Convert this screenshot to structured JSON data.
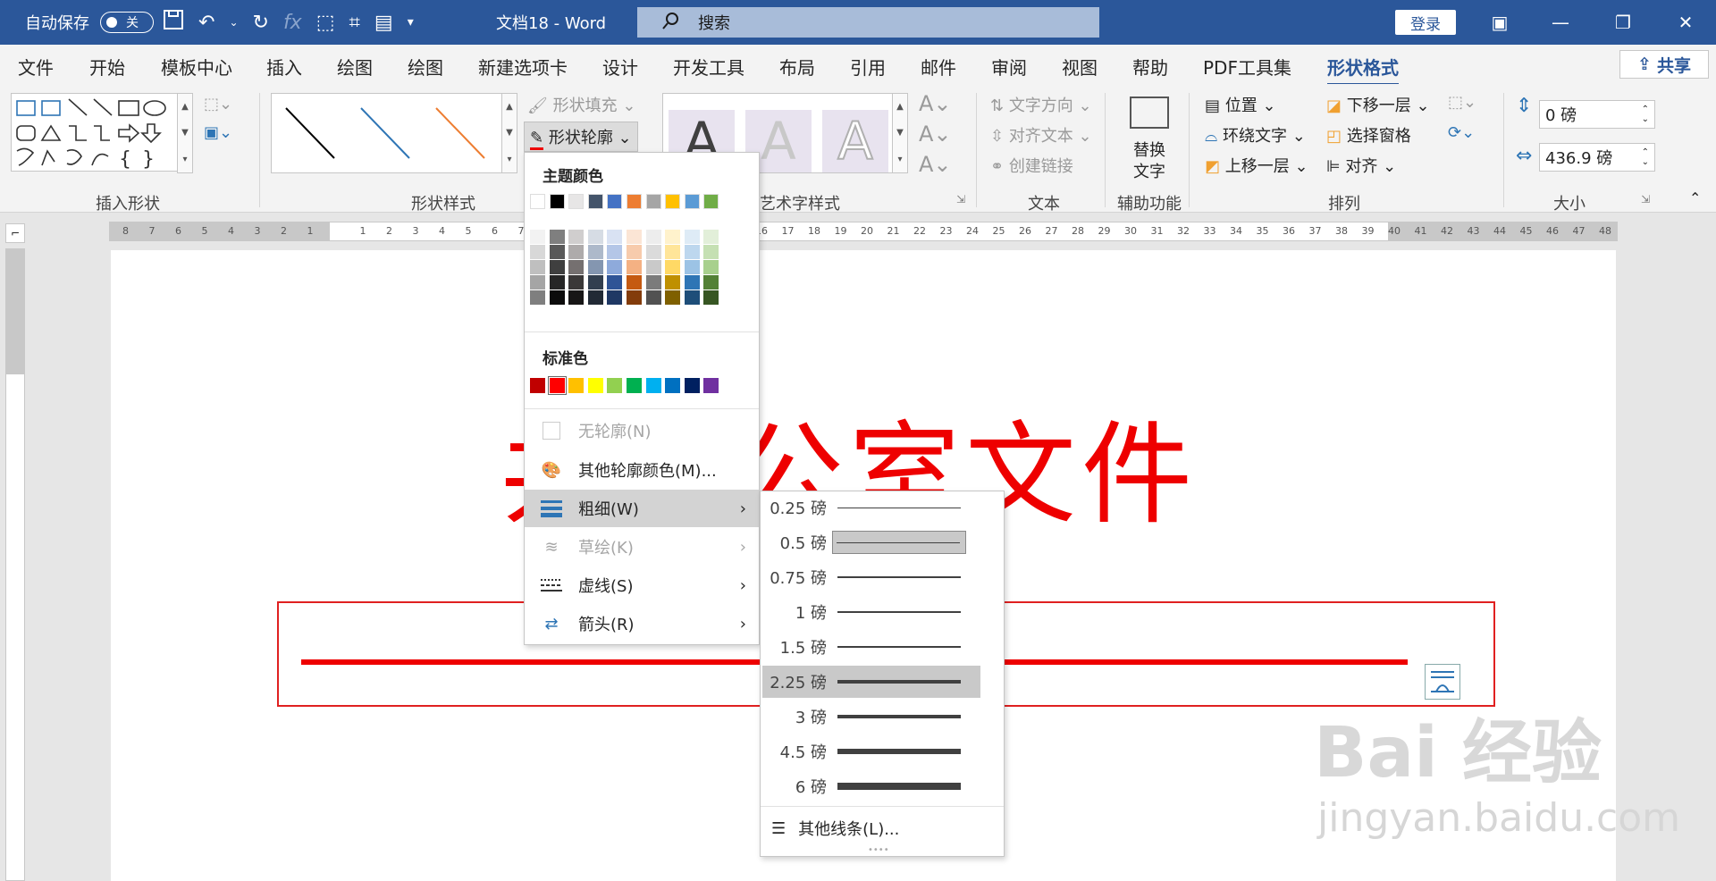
{
  "titlebar": {
    "autosave_label": "自动保存",
    "autosave_state": "关",
    "doc_title": "文档18 - Word",
    "search_placeholder": "搜索",
    "login_label": "登录"
  },
  "tabs": [
    "文件",
    "开始",
    "模板中心",
    "插入",
    "绘图",
    "绘图",
    "新建选项卡",
    "设计",
    "开发工具",
    "布局",
    "引用",
    "邮件",
    "审阅",
    "视图",
    "帮助",
    "PDF工具集",
    "形状格式"
  ],
  "active_tab": "形状格式",
  "share_label": "共享",
  "ribbon": {
    "groups": {
      "insert_shapes": "插入形状",
      "shape_styles": "形状样式",
      "wordart": "艺术字样式",
      "text": "文本",
      "accessibility": "辅助功能",
      "arrange": "排列",
      "size": "大小"
    },
    "shape_fill": "形状填充",
    "shape_outline": "形状轮廓",
    "text_direction": "文字方向",
    "align_text": "对齐文本",
    "create_link": "创建链接",
    "alt_text_line1": "替换",
    "alt_text_line2": "文字",
    "position": "位置",
    "wrap_text": "环绕文字",
    "bring_forward": "上移一层",
    "send_backward": "下移一层",
    "selection_pane": "选择窗格",
    "align": "对齐",
    "height_value": "0 磅",
    "width_value": "436.9 磅"
  },
  "document": {
    "heading_text": "某办公室文件",
    "heading_visible": "共办公室文件"
  },
  "outline_menu": {
    "theme_colors_title": "主题颜色",
    "standard_colors_title": "标准色",
    "items": [
      {
        "label": "无轮廓(N)",
        "disabled": true
      },
      {
        "label": "其他轮廓颜色(M)...",
        "disabled": false
      },
      {
        "label": "粗细(W)",
        "disabled": false,
        "submenu": true,
        "highlighted": true
      },
      {
        "label": "草绘(K)",
        "disabled": true,
        "submenu": true
      },
      {
        "label": "虚线(S)",
        "disabled": false,
        "submenu": true
      },
      {
        "label": "箭头(R)",
        "disabled": false,
        "submenu": true
      }
    ],
    "theme_top": [
      "#ffffff",
      "#000000",
      "#e7e6e6",
      "#44546a",
      "#4472c4",
      "#ed7d31",
      "#a5a5a5",
      "#ffc000",
      "#5b9bd5",
      "#70ad47"
    ],
    "theme_shades": [
      [
        "#f2f2f2",
        "#7f7f7f",
        "#d0cece",
        "#d6dce4",
        "#d9e2f3",
        "#fbe5d5",
        "#ededed",
        "#fff2cc",
        "#deebf6",
        "#e2efd9"
      ],
      [
        "#d8d8d8",
        "#595959",
        "#aeabab",
        "#adb9ca",
        "#b4c6e7",
        "#f7cbac",
        "#dbdbdb",
        "#ffe599",
        "#bdd7ee",
        "#c5e0b3"
      ],
      [
        "#bfbfbf",
        "#3f3f3f",
        "#757070",
        "#8496b0",
        "#8eaadb",
        "#f4b183",
        "#c9c9c9",
        "#ffd965",
        "#9cc3e5",
        "#a8d08d"
      ],
      [
        "#a5a5a5",
        "#262626",
        "#3a3838",
        "#323f4f",
        "#2f5496",
        "#c55a11",
        "#7b7b7b",
        "#bf9000",
        "#2e75b5",
        "#538135"
      ],
      [
        "#7f7f7f",
        "#0c0c0c",
        "#171616",
        "#222a35",
        "#1f3864",
        "#833c0b",
        "#525252",
        "#7f6000",
        "#1e4e79",
        "#375623"
      ]
    ],
    "standard": [
      "#c00000",
      "#ff0000",
      "#ffc000",
      "#ffff00",
      "#92d050",
      "#00b050",
      "#00b0f0",
      "#0070c0",
      "#002060",
      "#7030a0"
    ]
  },
  "weight_menu": {
    "items": [
      {
        "label": "0.25 磅",
        "thickness": 0.25
      },
      {
        "label": "0.5 磅",
        "thickness": 0.5,
        "selected": true
      },
      {
        "label": "0.75 磅",
        "thickness": 0.75
      },
      {
        "label": "1 磅",
        "thickness": 1
      },
      {
        "label": "1.5 磅",
        "thickness": 1.5
      },
      {
        "label": "2.25 磅",
        "thickness": 2.25,
        "highlighted": true
      },
      {
        "label": "3 磅",
        "thickness": 3
      },
      {
        "label": "4.5 磅",
        "thickness": 4.5
      },
      {
        "label": "6 磅",
        "thickness": 6
      }
    ],
    "more_lines": "其他线条(L)..."
  },
  "watermark": {
    "line1": "Bai  经验",
    "line2": "jingyan.baidu.com"
  }
}
